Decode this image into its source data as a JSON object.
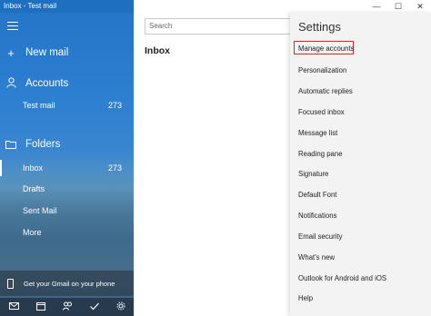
{
  "window": {
    "title": "Inbox - Test mail",
    "controls": {
      "minimize": "—",
      "maximize": "☐",
      "close": "✕"
    }
  },
  "sidebar": {
    "new_mail": "New mail",
    "accounts_label": "Accounts",
    "account": {
      "name": "Test mail",
      "count": "273"
    },
    "folders_label": "Folders",
    "folders": [
      {
        "name": "Inbox",
        "count": "273"
      },
      {
        "name": "Drafts",
        "count": ""
      },
      {
        "name": "Sent Mail",
        "count": ""
      },
      {
        "name": "More",
        "count": ""
      }
    ],
    "gmail_promo": "Get your Gmail on your phone"
  },
  "search": {
    "placeholder": "Search"
  },
  "main": {
    "title": "Inbox"
  },
  "settings": {
    "title": "Settings",
    "items": [
      "Manage accounts",
      "Personalization",
      "Automatic replies",
      "Focused inbox",
      "Message list",
      "Reading pane",
      "Signature",
      "Default Font",
      "Notifications",
      "Email security",
      "What's new",
      "Outlook for Android and iOS",
      "Help"
    ]
  },
  "colors": {
    "accent": "#2575c9",
    "highlight": "#dd2222"
  }
}
